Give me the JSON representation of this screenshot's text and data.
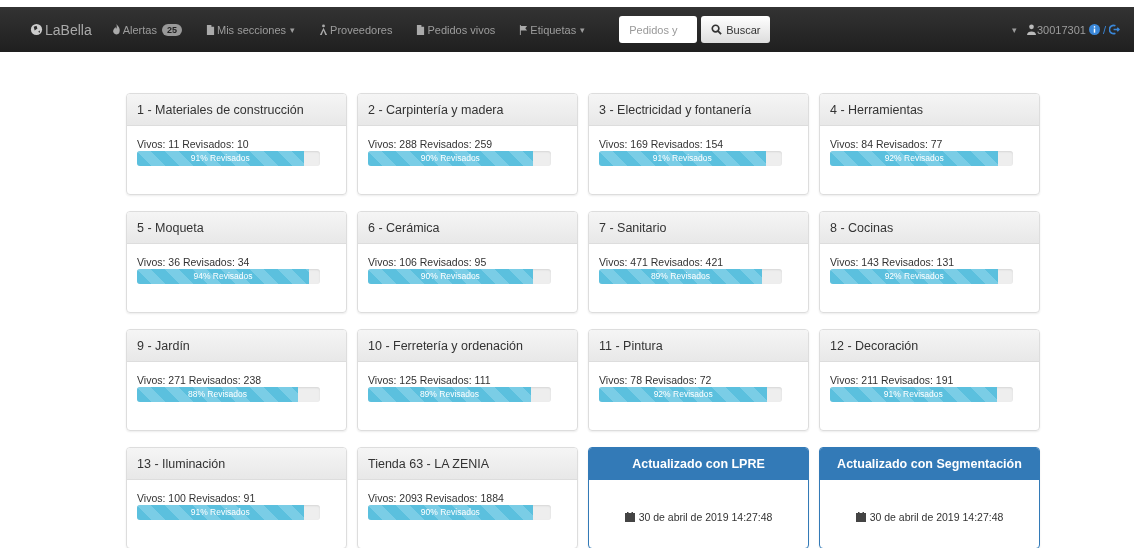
{
  "navbar": {
    "brand": "LaBella",
    "items": [
      {
        "kind": "alerts",
        "label": "Alertas",
        "badge": "25"
      },
      {
        "kind": "dropdown",
        "label": "Mis secciones",
        "caret": "▾"
      },
      {
        "kind": "suppliers",
        "label": "Proveedores"
      },
      {
        "kind": "orders",
        "label": "Pedidos vivos"
      },
      {
        "kind": "labels",
        "label": "Etiquetas",
        "caret": "▾"
      }
    ],
    "search": {
      "placeholder": "Pedidos y",
      "button": "Buscar"
    },
    "user": {
      "caret": "▾",
      "id": "30017301",
      "separator": "/"
    }
  },
  "cards": [
    {
      "kind": "progress",
      "title": "1 - Materiales de construcción",
      "stats": "Vivos: 11 Revisados: 10",
      "bar": "91% Revisados",
      "level": 0.91
    },
    {
      "kind": "progress",
      "title": "2 - Carpintería y madera",
      "stats": "Vivos: 288 Revisados: 259",
      "bar": "90% Revisados",
      "level": 0.9
    },
    {
      "kind": "progress",
      "title": "3 - Electricidad y fontanería",
      "stats": "Vivos: 169 Revisados: 154",
      "bar": "91% Revisados",
      "level": 0.91
    },
    {
      "kind": "progress",
      "title": "4 - Herramientas",
      "stats": "Vivos: 84 Revisados: 77",
      "bar": "92% Revisados",
      "level": 0.92
    },
    {
      "kind": "progress",
      "title": "5 - Moqueta",
      "stats": "Vivos: 36 Revisados: 34",
      "bar": "94% Revisados",
      "level": 0.94
    },
    {
      "kind": "progress",
      "title": "6 - Cerámica",
      "stats": "Vivos: 106 Revisados: 95",
      "bar": "90% Revisados",
      "level": 0.9
    },
    {
      "kind": "progress",
      "title": "7 - Sanitario",
      "stats": "Vivos: 471 Revisados: 421",
      "bar": "89% Revisados",
      "level": 0.89
    },
    {
      "kind": "progress",
      "title": "8 - Cocinas",
      "stats": "Vivos: 143 Revisados: 131",
      "bar": "92% Revisados",
      "level": 0.92
    },
    {
      "kind": "progress",
      "title": "9 - Jardín",
      "stats": "Vivos: 271 Revisados: 238",
      "bar": "88% Revisados",
      "level": 0.88
    },
    {
      "kind": "progress",
      "title": "10 - Ferretería y ordenación",
      "stats": "Vivos: 125 Revisados: 111",
      "bar": "89% Revisados",
      "level": 0.89
    },
    {
      "kind": "progress",
      "title": "11 - Pintura",
      "stats": "Vivos: 78 Revisados: 72",
      "bar": "92% Revisados",
      "level": 0.92
    },
    {
      "kind": "progress",
      "title": "12 - Decoración",
      "stats": "Vivos: 211 Revisados: 191",
      "bar": "91% Revisados",
      "level": 0.91
    },
    {
      "kind": "progress",
      "title": "13 - Iluminación",
      "stats": "Vivos: 100 Revisados: 91",
      "bar": "91% Revisados",
      "level": 0.91
    },
    {
      "kind": "progress",
      "title": "Tienda 63 - LA ZENIA",
      "stats": "Vivos: 2093 Revisados: 1884",
      "bar": "90% Revisados",
      "level": 0.9
    },
    {
      "kind": "update",
      "title": "Actualizado con LPRE",
      "date": "30 de abril de 2019 14:27:48"
    },
    {
      "kind": "update",
      "title": "Actualizado con Segmentación",
      "date": "30 de abril de 2019 14:27:48"
    }
  ]
}
